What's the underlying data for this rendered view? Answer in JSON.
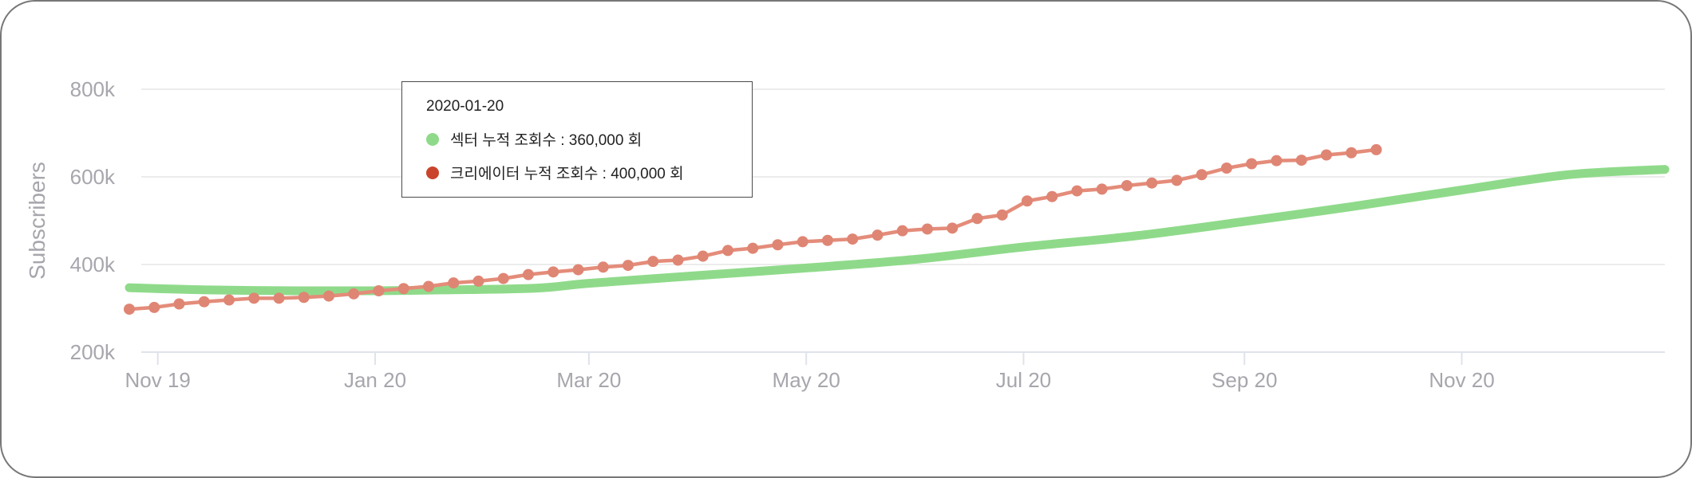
{
  "chart_data": {
    "type": "line",
    "ylabel": "Subscribers",
    "ylim": [
      200000,
      800000
    ],
    "y_ticks": [
      "200k",
      "400k",
      "600k",
      "800k"
    ],
    "x_ticks": [
      "Nov 19",
      "Jan 20",
      "Mar 20",
      "May 20",
      "Jul 20",
      "Sep 20",
      "Nov 20"
    ],
    "x_tick_dates": [
      "2019-11-01",
      "2020-01-01",
      "2020-03-01",
      "2020-05-01",
      "2020-07-01",
      "2020-09-01",
      "2020-11-01"
    ],
    "x_range": [
      "2019-10-24",
      "2020-12-28"
    ],
    "grid": true,
    "series": [
      {
        "name": "섹터 누적 조회수",
        "color": "#8fda8a",
        "markers": false,
        "points": [
          [
            "2019-10-24",
            347000
          ],
          [
            "2019-11-15",
            342000
          ],
          [
            "2019-12-10",
            340000
          ],
          [
            "2020-01-01",
            340000
          ],
          [
            "2020-01-20",
            342000
          ],
          [
            "2020-02-15",
            346000
          ],
          [
            "2020-03-01",
            357000
          ],
          [
            "2020-04-01",
            375000
          ],
          [
            "2020-05-01",
            392000
          ],
          [
            "2020-06-01",
            412000
          ],
          [
            "2020-07-01",
            440000
          ],
          [
            "2020-08-01",
            465000
          ],
          [
            "2020-09-01",
            498000
          ],
          [
            "2020-10-01",
            532000
          ],
          [
            "2020-11-01",
            570000
          ],
          [
            "2020-12-01",
            605000
          ],
          [
            "2020-12-28",
            617000
          ]
        ]
      },
      {
        "name": "크리에이터 누적 조회수",
        "color": "#e48c7a",
        "marker_color": "#df8574",
        "markers": true,
        "points": [
          [
            "2019-10-24",
            298000
          ],
          [
            "2019-10-31",
            302000
          ],
          [
            "2019-11-07",
            310000
          ],
          [
            "2019-11-14",
            315000
          ],
          [
            "2019-11-21",
            319000
          ],
          [
            "2019-11-28",
            323000
          ],
          [
            "2019-12-05",
            323000
          ],
          [
            "2019-12-12",
            325000
          ],
          [
            "2019-12-19",
            328000
          ],
          [
            "2019-12-26",
            333000
          ],
          [
            "2020-01-02",
            340000
          ],
          [
            "2020-01-09",
            345000
          ],
          [
            "2020-01-16",
            350000
          ],
          [
            "2020-01-23",
            358000
          ],
          [
            "2020-01-30",
            362000
          ],
          [
            "2020-02-06",
            368000
          ],
          [
            "2020-02-13",
            377000
          ],
          [
            "2020-02-20",
            383000
          ],
          [
            "2020-02-27",
            388000
          ],
          [
            "2020-03-05",
            394000
          ],
          [
            "2020-03-12",
            398000
          ],
          [
            "2020-03-19",
            407000
          ],
          [
            "2020-03-26",
            410000
          ],
          [
            "2020-04-02",
            419000
          ],
          [
            "2020-04-09",
            432000
          ],
          [
            "2020-04-16",
            437000
          ],
          [
            "2020-04-23",
            445000
          ],
          [
            "2020-04-30",
            452000
          ],
          [
            "2020-05-07",
            455000
          ],
          [
            "2020-05-14",
            458000
          ],
          [
            "2020-05-21",
            467000
          ],
          [
            "2020-05-28",
            477000
          ],
          [
            "2020-06-04",
            481000
          ],
          [
            "2020-06-11",
            483000
          ],
          [
            "2020-06-18",
            505000
          ],
          [
            "2020-06-25",
            513000
          ],
          [
            "2020-07-02",
            545000
          ],
          [
            "2020-07-09",
            555000
          ],
          [
            "2020-07-16",
            568000
          ],
          [
            "2020-07-23",
            572000
          ],
          [
            "2020-07-30",
            580000
          ],
          [
            "2020-08-06",
            586000
          ],
          [
            "2020-08-13",
            592000
          ],
          [
            "2020-08-20",
            605000
          ],
          [
            "2020-08-27",
            620000
          ],
          [
            "2020-09-03",
            630000
          ],
          [
            "2020-09-10",
            637000
          ],
          [
            "2020-09-17",
            638000
          ],
          [
            "2020-09-24",
            650000
          ],
          [
            "2020-10-01",
            655000
          ],
          [
            "2020-10-08",
            662000
          ]
        ]
      }
    ],
    "tooltip": {
      "date": "2020-01-20",
      "rows": [
        {
          "label": "섹터 누적 조회수 : 360,000 회",
          "color": "#8fda8a"
        },
        {
          "label": "크리에이터 누적 조회수 : 400,000 회",
          "color": "#c9442b"
        }
      ]
    }
  }
}
